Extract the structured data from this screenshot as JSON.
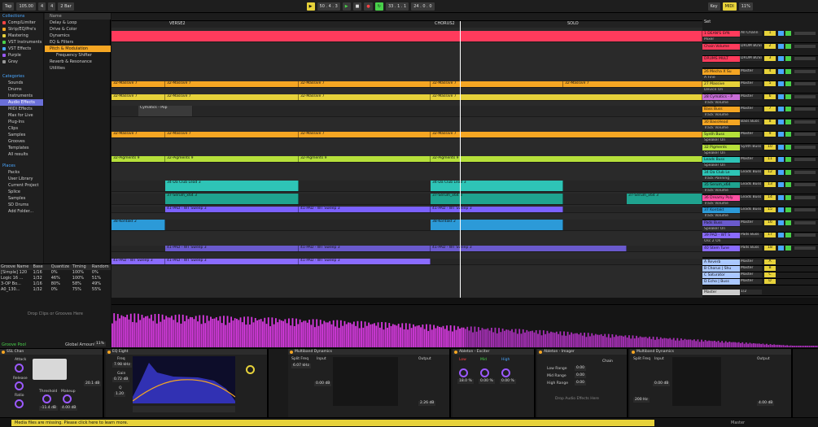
{
  "transport": {
    "tap": "Tap",
    "tempo": "105.00",
    "sig_num": "4",
    "sig_den": "4",
    "metronome": "2 Bar",
    "position": "50 . 4 . 3",
    "loop_start": "33 . 1 . 1",
    "loop_len": "24 . 0 . 0",
    "key": "Key",
    "midi": "MIDI",
    "cpu": "11%"
  },
  "browser": {
    "collections_title": "Collections",
    "collections": [
      {
        "label": "Comp/Limiter",
        "color": "#ff4444"
      },
      {
        "label": "Strip/EQ/Pre's",
        "color": "#f5a623"
      },
      {
        "label": "Mastering",
        "color": "#e7d23a"
      },
      {
        "label": "VST Instruments",
        "color": "#48d14a"
      },
      {
        "label": "VST Effects",
        "color": "#4aa7ff"
      },
      {
        "label": "Purple",
        "color": "#9b59ff"
      },
      {
        "label": "Gray",
        "color": "#999999"
      }
    ],
    "categories_title": "Categories",
    "categories": [
      "Sounds",
      "Drums",
      "Instruments",
      "Audio Effects",
      "MIDI Effects",
      "Max for Live",
      "Plug-Ins",
      "Clips",
      "Samples",
      "Grooves",
      "Templates",
      "All results"
    ],
    "categories_selected": 3,
    "places_title": "Places",
    "places": [
      "Packs",
      "User Library",
      "Current Project",
      "Splice",
      "Samples",
      "SD Drums",
      "Add Folder..."
    ],
    "name_header": "Name",
    "files": [
      "Delay & Loop",
      "Drive & Color",
      "Dynamics",
      "EQ & Filters",
      "Pitch & Modulation",
      "Frequency Shifter",
      "Reverb & Resonance",
      "Utilities"
    ],
    "files_selected": 4
  },
  "groove_pool": {
    "columns": [
      "Groove Name",
      "Base",
      "Quantize",
      "Timing",
      "Random"
    ],
    "rows": [
      [
        "[Simple] 120",
        "1/16",
        "0%",
        "100%",
        "0%"
      ],
      [
        "Logic 16 ...",
        "1/32",
        "46%",
        "100%",
        "51%"
      ],
      [
        "3-OP Bo...",
        "1/16",
        "80%",
        "58%",
        "49%"
      ],
      [
        "A0_130...",
        "1/32",
        "0%",
        "75%",
        "55%"
      ]
    ],
    "drop_hint": "Drop Clips or Grooves Here",
    "title": "Groove Pool",
    "global_label": "Global Amount",
    "global_value": "11%"
  },
  "arrangement": {
    "locators": [
      "VERSE2",
      "CHORUS2",
      "SOLO"
    ],
    "set_label": "Set",
    "lanes": [
      {
        "clips": [
          {
            "label": "",
            "color": "#ff3b5c"
          }
        ]
      },
      {
        "clips": [
          {
            "label": "32-Massive 7",
            "color": "#f5a623"
          },
          {
            "label": "32-Massive 7",
            "color": "#f5a623"
          },
          {
            "label": "32-Massive 7",
            "color": "#f5a623"
          },
          {
            "label": "32-Massive 7",
            "color": "#f5a623"
          },
          {
            "label": "32-Massive 7",
            "color": "#f5a623"
          }
        ]
      },
      {
        "clips": [
          {
            "label": "32-Massive 7",
            "color": "#e7d23a"
          },
          {
            "label": "32-Massive 7",
            "color": "#e7d23a"
          },
          {
            "label": "32-Massive 7",
            "color": "#e7d23a"
          },
          {
            "label": "32-Massive 7",
            "color": "#e7d23a"
          }
        ]
      },
      {
        "clips": [
          {
            "label": "Cymatics - Pop",
            "color": "#3a3a3a"
          }
        ]
      },
      {
        "clips": [
          {
            "label": "32-Massive 7",
            "color": "#f5a623"
          },
          {
            "label": "32-Massive 7",
            "color": "#f5a623"
          },
          {
            "label": "32-Massive 7",
            "color": "#f5a623"
          },
          {
            "label": "32-Massive 7",
            "color": "#f5a623"
          }
        ]
      },
      {
        "clips": [
          {
            "label": "32-Pigments 9",
            "color": "#b6e03a"
          },
          {
            "label": "32-Pigments 9",
            "color": "#b6e03a"
          },
          {
            "label": "32-Pigments 9",
            "color": "#b6e03a"
          },
          {
            "label": "32-Pigments 9",
            "color": "#b6e03a"
          }
        ]
      },
      {
        "clips": [
          {
            "label": "34-Da Club Lead 3",
            "color": "#2ec4b6"
          },
          {
            "label": "34-Da Club Lead 3",
            "color": "#2ec4b6"
          }
        ]
      },
      {
        "clips": [
          {
            "label": "37-Serum_x64 3",
            "color": "#1fa38f"
          },
          {
            "label": "37-Serum_x64 3",
            "color": "#1fa38f"
          },
          {
            "label": "37-Serum_x64 3",
            "color": "#1fa38f"
          }
        ]
      },
      {
        "clips": [
          {
            "label": "41-PAD - WT Sweep 3",
            "color": "#7b61ff"
          },
          {
            "label": "41-PAD - WT Sweep 3",
            "color": "#7b61ff"
          },
          {
            "label": "41-PAD - WT Sweep 3",
            "color": "#7b61ff"
          }
        ]
      },
      {
        "clips": [
          {
            "label": "38-Kontakt 2",
            "color": "#2c9ad8"
          },
          {
            "label": "38-Kontakt 2",
            "color": "#2c9ad8"
          }
        ]
      },
      {
        "clips": [
          {
            "label": "41-PAD - WT Sweep 3",
            "color": "#6a5acd"
          },
          {
            "label": "41-PAD - WT Sweep 3",
            "color": "#6a5acd"
          },
          {
            "label": "41-PAD - WT Sweep 3",
            "color": "#6a5acd"
          }
        ]
      },
      {
        "clips": [
          {
            "label": "41-PAD - WT Sweep 3",
            "color": "#8a6bff"
          },
          {
            "label": "41-PAD - WT Sweep 3",
            "color": "#8a6bff"
          },
          {
            "label": "41-PAD - WT Sweep 3",
            "color": "#8a6bff"
          }
        ]
      }
    ]
  },
  "mixer": {
    "tracks": [
      {
        "name": "1 DEAN'S SYN",
        "sub": "Mixer",
        "route": "All Chann",
        "num": "1",
        "color": "#ff3b5c"
      },
      {
        "name": "Chain Volume",
        "sub": "",
        "route": "DRUM BUSS",
        "num": "2",
        "color": "#ff3b5c"
      },
      {
        "name": "DRUMS MULT",
        "sub": "",
        "route": "DRUM BUSS",
        "num": "3",
        "color": "#ff3b5c"
      },
      {
        "name": "26 Mecha X Su",
        "sub": "A Fine",
        "route": "Master",
        "num": "4",
        "color": "#f5a623"
      },
      {
        "name": "27 Massive",
        "sub": "Device On",
        "route": "Master",
        "num": "5",
        "color": "#e7d23a"
      },
      {
        "name": "28 Cymatics - P",
        "sub": "Track Volume",
        "route": "Master",
        "num": "6",
        "color": "#c86dd7"
      },
      {
        "name": "Bass Buss",
        "sub": "Track Volume",
        "route": "Master",
        "num": "7",
        "color": "#f5a623"
      },
      {
        "name": "30 BassHead",
        "sub": "Track Volume",
        "route": "Bass Buss",
        "num": "8",
        "color": "#f5a623"
      },
      {
        "name": "Synth Buss",
        "sub": "Speaker On",
        "route": "Master",
        "num": "9",
        "color": "#b6e03a"
      },
      {
        "name": "32 Pigments",
        "sub": "Speaker On",
        "route": "Synth Buss",
        "num": "10",
        "color": "#b6e03a"
      },
      {
        "name": "Leads Buss",
        "sub": "Speaker On",
        "route": "Master",
        "num": "11",
        "color": "#2ec4b6"
      },
      {
        "name": "34 Da Club Le",
        "sub": "Track Panning",
        "route": "Leads Buss",
        "num": "12",
        "color": "#2ec4b6"
      },
      {
        "name": "35 Serum_x64",
        "sub": "Track Volume",
        "route": "Leads Buss",
        "num": "13",
        "color": "#1fa38f"
      },
      {
        "name": "36 Dreamy Poly",
        "sub": "Track Volume",
        "route": "Leads Buss",
        "num": "14",
        "color": "#ff4fa3"
      },
      {
        "name": "37 Kontakt",
        "sub": "Track Volume",
        "route": "Leads Buss",
        "num": "15",
        "color": "#2c9ad8"
      },
      {
        "name": "Pads Buss",
        "sub": "Speaker On",
        "route": "Master",
        "num": "16",
        "color": "#6a5acd"
      },
      {
        "name": "39 PAD - WT S",
        "sub": "Osc 2 On",
        "route": "Pads Buss",
        "num": "17",
        "color": "#8a6bff"
      },
      {
        "name": "40 Stem Tune",
        "sub": "",
        "route": "Pads Buss",
        "num": "18",
        "color": "#8a6bff"
      }
    ],
    "returns": [
      {
        "name": "A Reverb",
        "route": "Master",
        "num": "A"
      },
      {
        "name": "B Chorus | Shu",
        "route": "Master",
        "num": "B"
      },
      {
        "name": "C Saturator",
        "route": "Master",
        "num": "C"
      },
      {
        "name": "D Echo | Buss",
        "route": "Master",
        "num": "D"
      }
    ],
    "master_label": "Master",
    "master_route": "1/2"
  },
  "devices": [
    {
      "title": "SSL Chan",
      "knobs": [
        "Attack",
        "Release",
        "Ratio",
        "Threshold",
        "Makeup"
      ],
      "values": [
        "-11.4 dB",
        "4.00 dB",
        "20.1 dB"
      ]
    },
    {
      "title": "EQ Eight",
      "knobs": [
        "Freq",
        "Gain",
        "Q"
      ],
      "values": [
        "7.98 kHz",
        "0.72 dB",
        "1.20"
      ]
    },
    {
      "title": "Multiband Dynamics",
      "knobs": [
        "Split Freq",
        "Input",
        "Output"
      ],
      "values": [
        "6.07 kHz",
        "0.00 dB",
        "2.26 dB"
      ]
    },
    {
      "title": "Ableton - Exciter",
      "knobs": [
        "Low",
        "Mid",
        "High"
      ],
      "values": [
        "18.0 %",
        "0.00 %",
        "0.00 %"
      ]
    },
    {
      "title": "Ableton - Imager",
      "ranges": [
        "Low Range",
        "Mid Range",
        "High Range"
      ],
      "values": [
        "0.00",
        "0.00",
        "0.00"
      ],
      "chain": "Chain",
      "drop_hint": "Drop Audio Effects Here"
    },
    {
      "title": "Multiband Dynamics",
      "knobs": [
        "Split Freq",
        "Input",
        "Output"
      ],
      "values": [
        "200 Hz",
        "0.00 dB",
        "4.00 dB"
      ]
    }
  ],
  "status": {
    "message": "Media files are missing. Please click here to learn more.",
    "right": "Master"
  }
}
